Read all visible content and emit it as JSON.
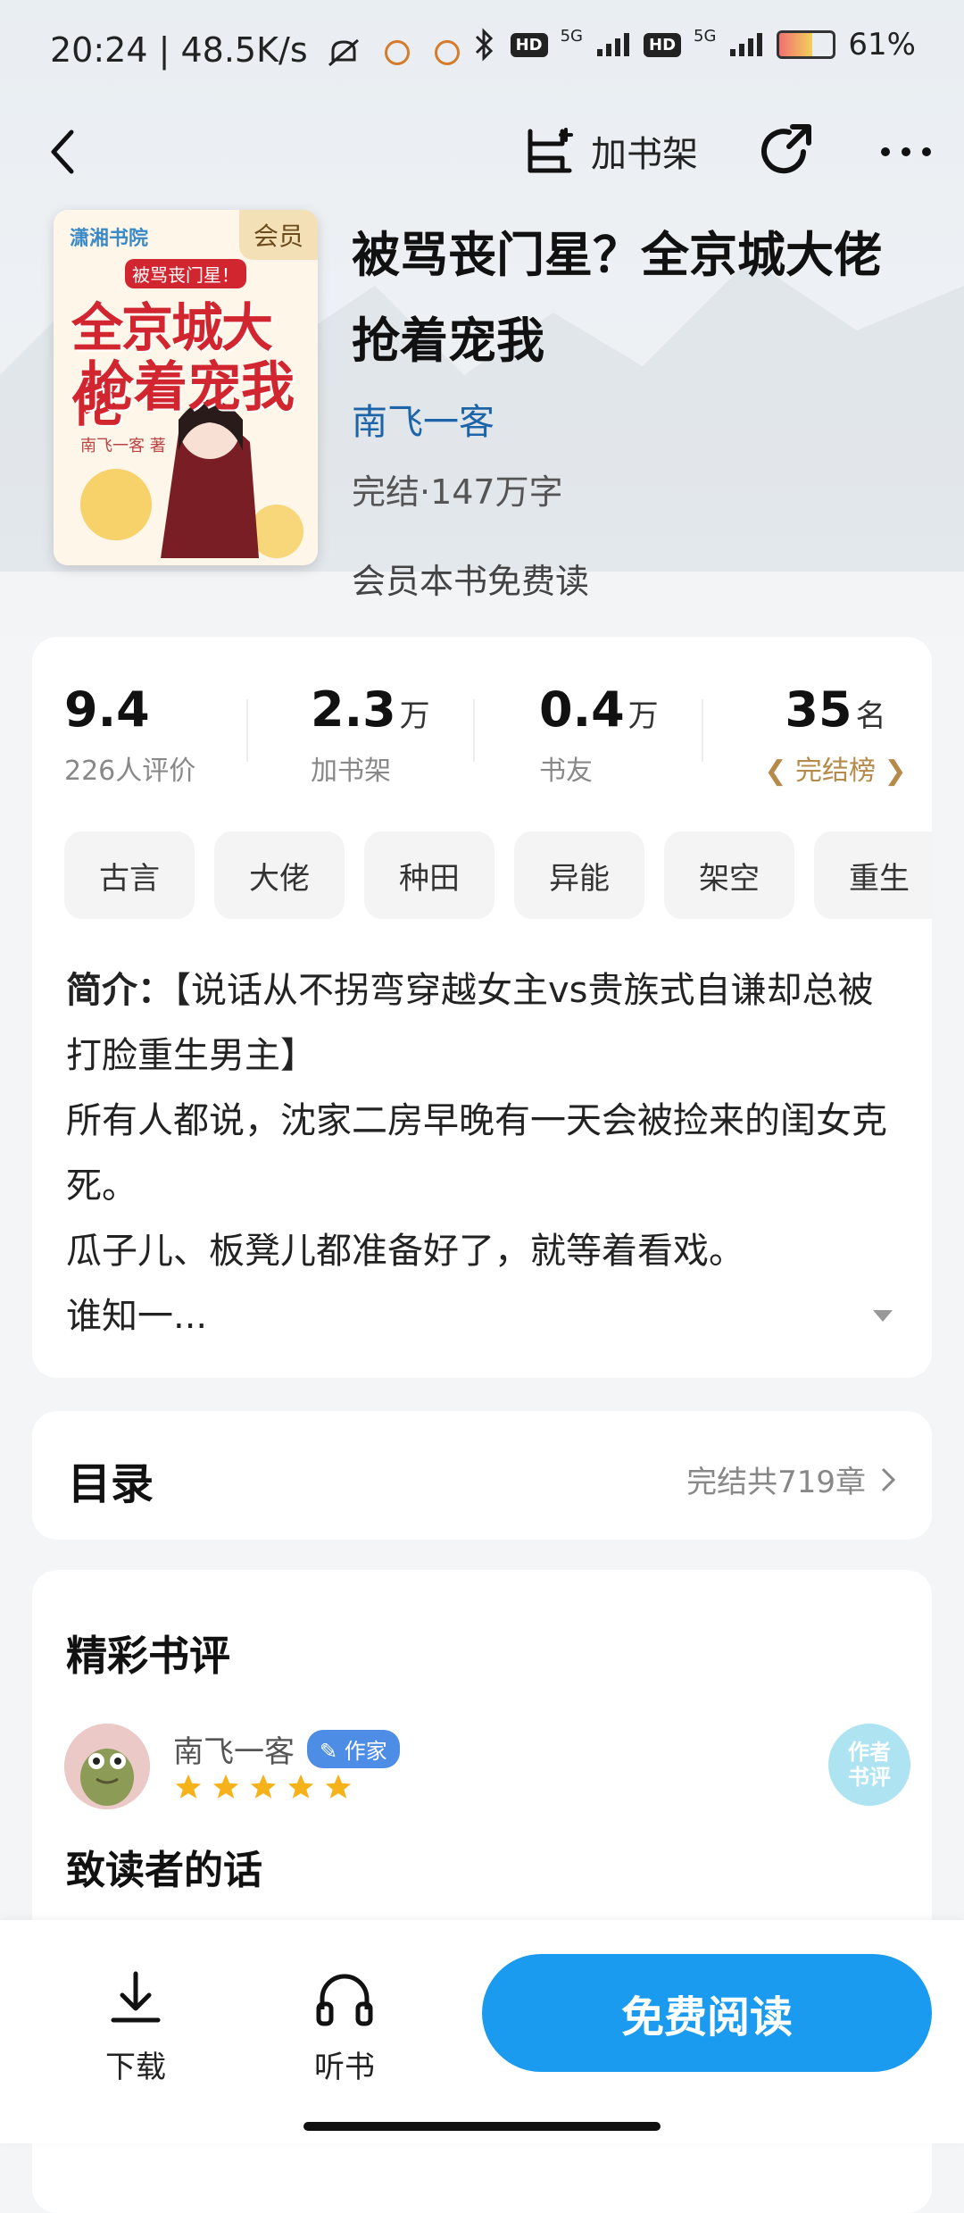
{
  "status_bar": {
    "time": "20:24",
    "net_speed": "48.5K/s",
    "hd1": "HD",
    "sig1": "5G",
    "hd2": "HD",
    "sig2": "5G",
    "battery": "61%",
    "battery_level": 0.61
  },
  "top_bar": {
    "add_shelf_label": "加书架"
  },
  "book": {
    "vip_tag": "会员",
    "cover_logo": "潇湘书院",
    "cover_sub": "被骂丧门星！",
    "cover_title_line1": "全京城大佬",
    "cover_title_line2": "抢着宠我",
    "cover_author": "南飞一客 著",
    "title": "被骂丧门星？全京城大佬抢着宠我",
    "author": "南飞一客",
    "meta": "完结·147万字",
    "free_note": "会员本书免费读"
  },
  "stats": [
    {
      "value": "9.4",
      "unit": "",
      "label": "226人评价"
    },
    {
      "value": "2.3",
      "unit": "万",
      "label": "加书架"
    },
    {
      "value": "0.4",
      "unit": "万",
      "label": "书友"
    },
    {
      "value": "35",
      "unit": "名",
      "label": "完结榜"
    }
  ],
  "tags": [
    "古言",
    "大佬",
    "种田",
    "异能",
    "架空",
    "重生"
  ],
  "intro": {
    "label": "简介：",
    "line1": "【说话从不拐弯穿越女主vs贵族式自谦却总被打脸重生男主】",
    "line2": "所有人都说，沈家二房早晚有一天会被捡来的闺女克死。",
    "line3": "瓜子儿、板凳儿都准备好了，就等着看戏。",
    "line4": "谁知一..."
  },
  "toc": {
    "title": "目录",
    "summary": "完结共719章"
  },
  "reviews": {
    "title": "精彩书评",
    "reviewer": "南飞一客",
    "badge": "作家",
    "rating": 5,
    "stamp_line1": "作者",
    "stamp_line2": "书评",
    "heading": "致读者的话"
  },
  "bottom_bar": {
    "download": "下载",
    "listen": "听书",
    "read": "免费阅读"
  },
  "colors": {
    "accent": "#1a9bf0",
    "author_link": "#1d64a8",
    "rank_gold": "#b58a4a",
    "star": "#f6b21a"
  }
}
